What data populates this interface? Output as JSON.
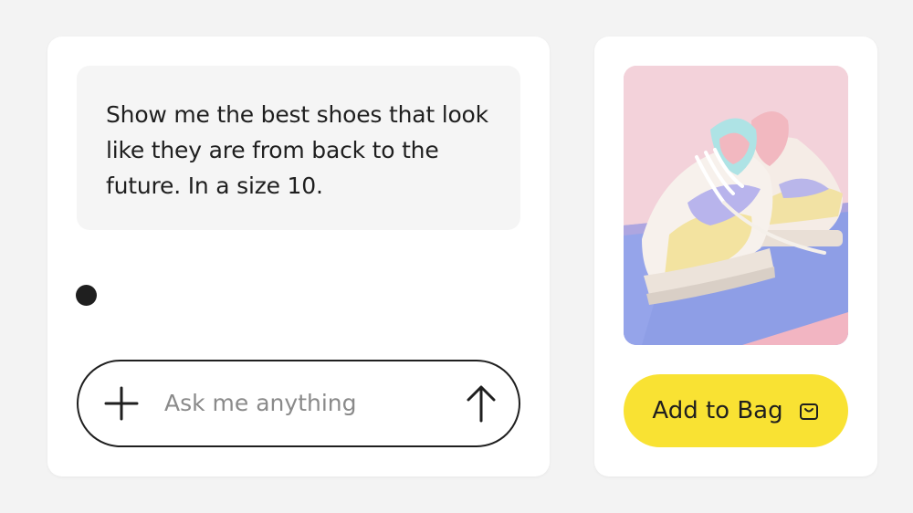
{
  "chat": {
    "message": "Show me the best shoes that look like they are from back to the future. In a size 10.",
    "input_placeholder": "Ask me anything",
    "icons": {
      "add": "plus-icon",
      "send": "arrow-up-icon"
    }
  },
  "product": {
    "image_description": "pastel sneakers",
    "add_label": "Add to Bag",
    "icons": {
      "bag": "shopping-bag-icon"
    },
    "accent_color": "#f9e233"
  }
}
